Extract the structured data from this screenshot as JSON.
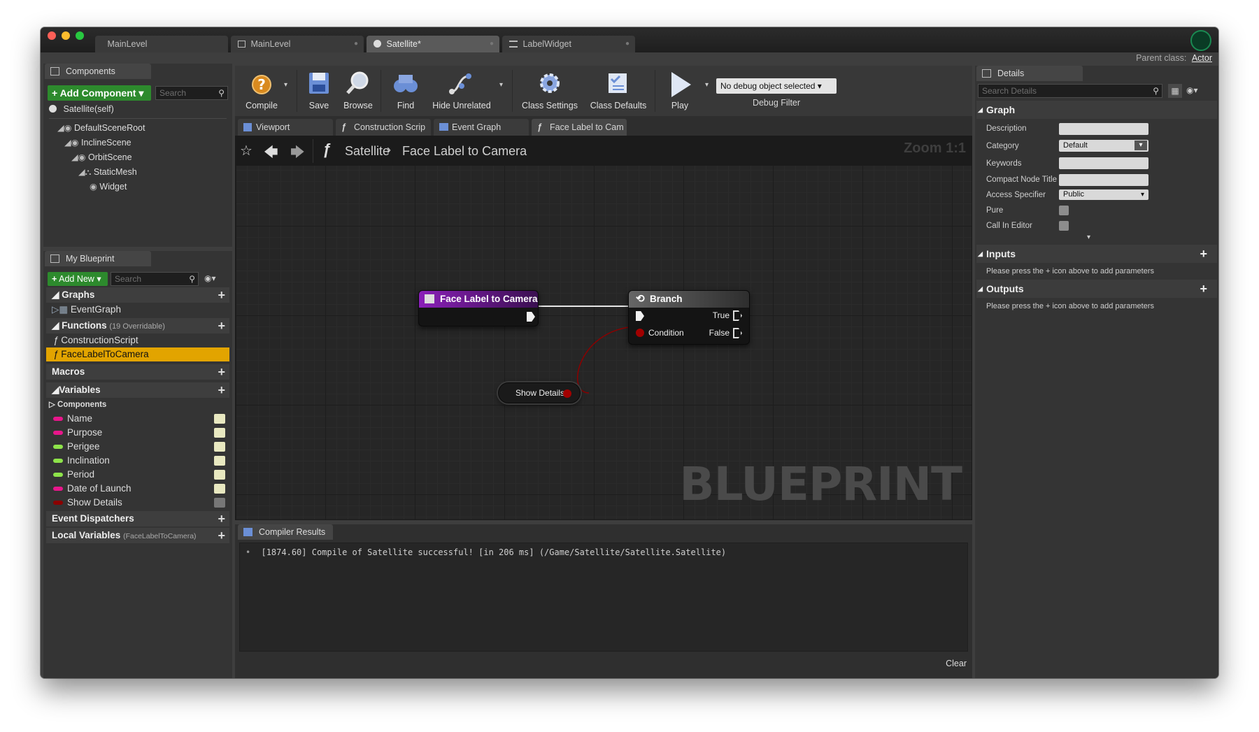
{
  "window": {
    "parent_class_label": "Parent class:",
    "parent_class_value": "Actor",
    "doc_tabs": [
      "MainLevel",
      "MainLevel",
      "Satellite*",
      "LabelWidget"
    ]
  },
  "components_panel": {
    "tab": "Components",
    "add_button": "Add Component",
    "search_placeholder": "Search",
    "self_item": "Satellite(self)",
    "tree": [
      "DefaultSceneRoot",
      "InclineScene",
      "OrbitScene",
      "StaticMesh",
      "Widget"
    ]
  },
  "my_blueprint": {
    "tab": "My Blueprint",
    "add_new": "Add New",
    "search_placeholder": "Search",
    "graphs_header": "Graphs",
    "graphs": [
      "EventGraph"
    ],
    "functions_header": "Functions",
    "functions_count": "(19 Overridable)",
    "functions": [
      "ConstructionScript",
      "FaceLabelToCamera"
    ],
    "macros_header": "Macros",
    "variables_header": "Variables",
    "components_subheader": "Components",
    "variables": [
      {
        "name": "Name",
        "color": "#e8168b"
      },
      {
        "name": "Purpose",
        "color": "#e8168b"
      },
      {
        "name": "Perigee",
        "color": "#8ee34a"
      },
      {
        "name": "Inclination",
        "color": "#8ee34a"
      },
      {
        "name": "Period",
        "color": "#8ee34a"
      },
      {
        "name": "Date of Launch",
        "color": "#e8168b"
      },
      {
        "name": "Show Details",
        "color": "#8b0000"
      }
    ],
    "dispatchers_header": "Event Dispatchers",
    "locals_header": "Local Variables",
    "locals_scope": "(FaceLabelToCamera)"
  },
  "toolbar": {
    "compile": "Compile",
    "save": "Save",
    "browse": "Browse",
    "find": "Find",
    "hide_unrelated": "Hide Unrelated",
    "class_settings": "Class Settings",
    "class_defaults": "Class Defaults",
    "play": "Play",
    "debug_select": "No debug object selected",
    "debug_filter": "Debug Filter"
  },
  "graph_tabs": [
    "Viewport",
    "Construction Scrip",
    "Event Graph",
    "Face Label to Cam"
  ],
  "graph": {
    "breadcrumb_root": "Satellite",
    "breadcrumb_current": "Face Label to Camera",
    "zoom": "Zoom 1:1",
    "watermark": "BLUEPRINT",
    "entry_node_title": "Face Label to Camera",
    "branch_node_title": "Branch",
    "branch_true": "True",
    "branch_condition": "Condition",
    "branch_false": "False",
    "getter_label": "Show Details"
  },
  "compiler": {
    "tab": "Compiler Results",
    "message": "[1874.60] Compile of Satellite successful! [in 206 ms] (/Game/Satellite/Satellite.Satellite)",
    "clear": "Clear"
  },
  "details": {
    "tab": "Details",
    "search_placeholder": "Search Details",
    "graph_section": "Graph",
    "description_label": "Description",
    "category_label": "Category",
    "category_value": "Default",
    "keywords_label": "Keywords",
    "compact_label": "Compact Node Title",
    "access_label": "Access Specifier",
    "access_value": "Public",
    "pure_label": "Pure",
    "call_in_editor_label": "Call In Editor",
    "inputs_section": "Inputs",
    "inputs_hint": "Please press the + icon above to add parameters",
    "outputs_section": "Outputs",
    "outputs_hint": "Please press the + icon above to add parameters"
  }
}
